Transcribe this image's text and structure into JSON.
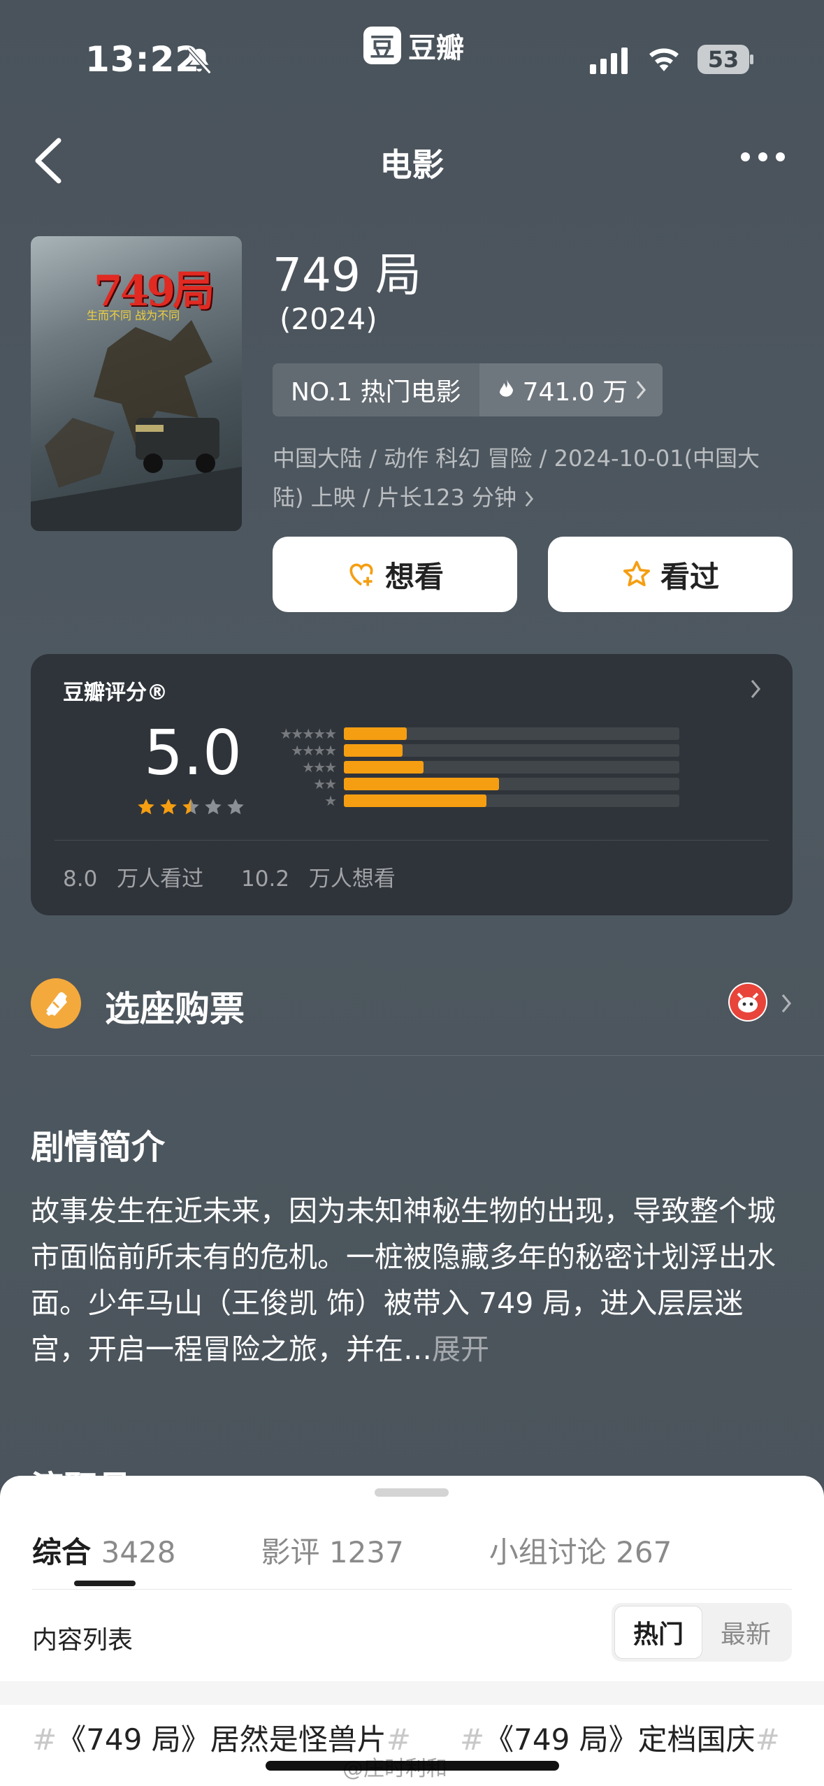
{
  "status_bar": {
    "time": "13:22",
    "app_name": "豆瓣",
    "app_logo": "豆",
    "battery": "53"
  },
  "nav": {
    "title": "电影"
  },
  "movie": {
    "title": "749 局",
    "year": "(2024)",
    "poster_title": "749局",
    "poster_tagline": "生而不同  战为不同",
    "rank": "NO.1 热门电影",
    "heat": "741.0 万",
    "meta": "中国大陆 / 动作 科幻 冒险 / 2024-10-01(中国大陆) 上映 / 片长123 分钟",
    "want_label": "想看",
    "seen_label": "看过"
  },
  "rating": {
    "label": "豆瓣评分®",
    "score": "5.0",
    "star_value": 2.5,
    "distribution": [
      {
        "stars": "★★★★★",
        "percent": 7.5
      },
      {
        "stars": "★★★★",
        "percent": 7
      },
      {
        "stars": "★★★",
        "percent": 9.5
      },
      {
        "stars": "★★",
        "percent": 18.5
      },
      {
        "stars": "★",
        "percent": 17
      }
    ],
    "seen_count": "8.0 万人看过",
    "want_count": "10.2 万人想看"
  },
  "ticket": {
    "label": "选座购票"
  },
  "synopsis": {
    "heading": "剧情简介",
    "text": "故事发生在近未来，因为未知神秘生物的出现，导致整个城市面临前所未有的危机。一桩被隐藏多年的秘密计划浮出水面。少年马山（王俊凯 饰）被带入 749 局，进入层层迷宫，开启一程冒险之旅，并在…",
    "expand": "展开"
  },
  "cast_heading_peek": "演职员",
  "sheet": {
    "tabs": [
      {
        "label": "综合",
        "count": "3428"
      },
      {
        "label": "影评",
        "count": "1237"
      },
      {
        "label": "小组讨论",
        "count": "267"
      }
    ],
    "list_heading": "内容列表",
    "sort_hot": "热门",
    "sort_new": "最新",
    "topics": [
      "《749 局》居然是怪兽片",
      "《749 局》定档国庆"
    ],
    "watermark": "@庄时利和"
  },
  "colors": {
    "accent": "#f59e12",
    "background": "#4c565e"
  }
}
